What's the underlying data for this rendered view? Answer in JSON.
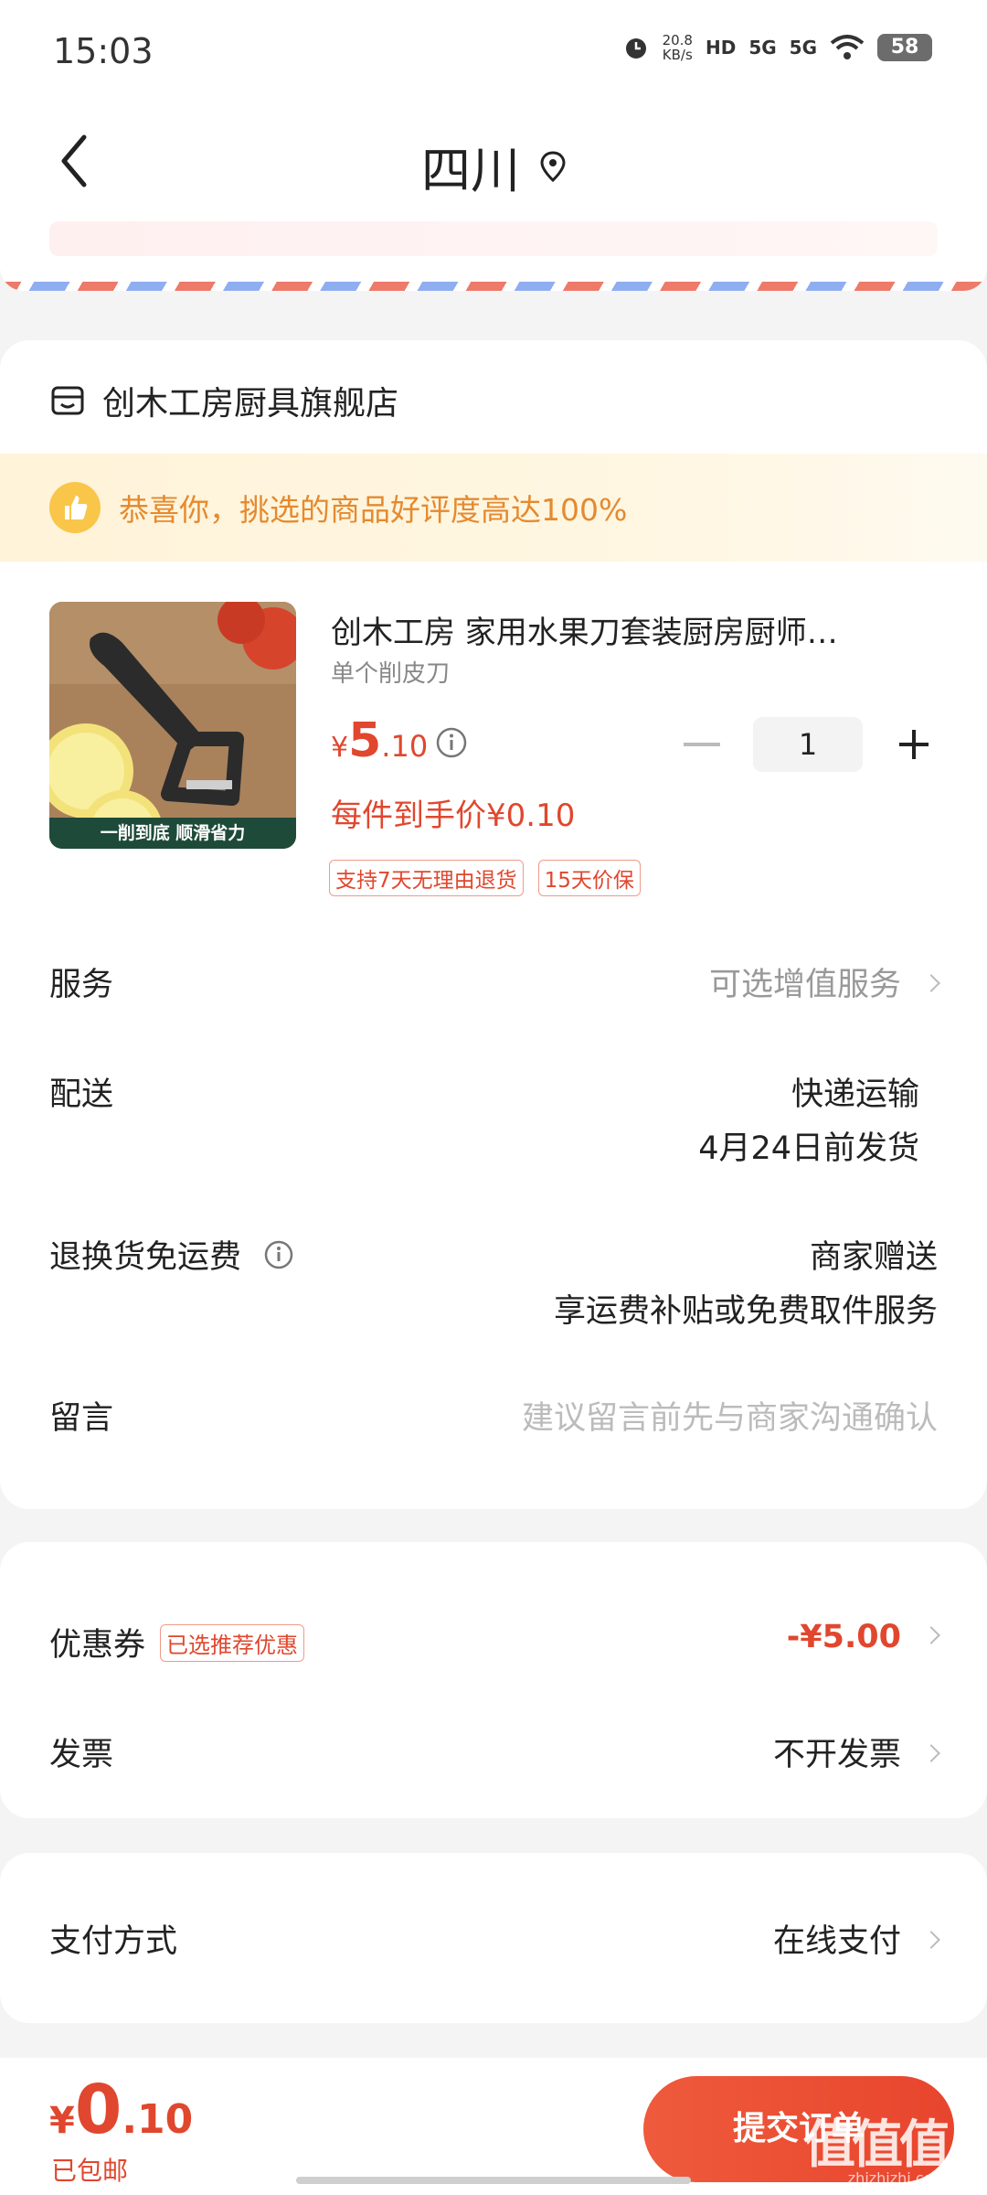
{
  "status_bar": {
    "time": "15:03",
    "speed_value": "20.8",
    "speed_unit": "KB/s",
    "hd": "HD",
    "signal1": "5G",
    "signal2": "5G",
    "battery": "58"
  },
  "header": {
    "title": "四川",
    "icons": {
      "back": "back-arrow-icon",
      "location": "location-pin-icon"
    }
  },
  "shop": {
    "name": "创木工房厨具旗舰店",
    "icon": "shop-icon"
  },
  "praise": {
    "text": "恭喜你，挑选的商品好评度高达100%",
    "icon": "thumbs-up-icon"
  },
  "product": {
    "title": "创木工房 家用水果刀套装厨房厨师…",
    "spec": "单个削皮刀",
    "price_symbol": "¥",
    "price_int": "5",
    "price_dec": ".10",
    "quantity": "1",
    "deal_price": "每件到手价¥0.10",
    "image_caption": "一削到底  顺滑省力",
    "tags": [
      "支持7天无理由退货",
      "15天价保"
    ]
  },
  "rows": {
    "service_label": "服务",
    "service_value": "可选增值服务",
    "delivery_label": "配送",
    "delivery_value1": "快递运输",
    "delivery_value2": "4月24日前发货",
    "return_label": "退换货免运费",
    "return_value1": "商家赠送",
    "return_value2": "享运费补贴或免费取件服务",
    "message_label": "留言",
    "message_placeholder": "建议留言前先与商家沟通确认"
  },
  "coupon": {
    "label": "优惠券",
    "tag": "已选推荐优惠",
    "value": "-¥5.00",
    "invoice_label": "发票",
    "invoice_value": "不开发票"
  },
  "payment": {
    "label": "支付方式",
    "value": "在线支付"
  },
  "bottom": {
    "symbol": "¥",
    "int": "0",
    "dec": ".10",
    "shipping": "已包邮",
    "submit": "提交订单",
    "watermark": "值值值",
    "watermark_sub": "zhizhizhi.com"
  },
  "colors": {
    "accent": "#e0472e",
    "praise_text": "#e58a2e",
    "background": "#f4f4f4"
  }
}
